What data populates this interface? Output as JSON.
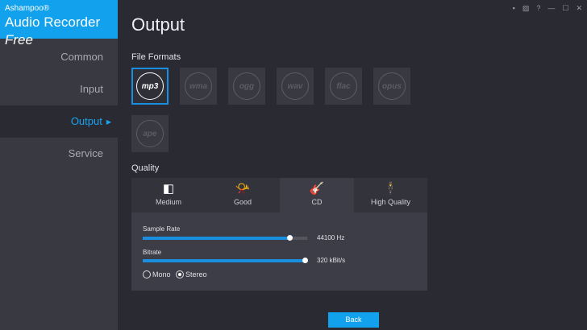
{
  "app": {
    "brand_small": "Ashampoo®",
    "brand_main": "Audio Recorder",
    "brand_italic": "Free"
  },
  "window_controls": [
    {
      "icon": "note-icon",
      "glyph": "▪"
    },
    {
      "icon": "edit-icon",
      "glyph": "▨"
    },
    {
      "icon": "help-icon",
      "glyph": "?"
    },
    {
      "icon": "minimize-icon",
      "glyph": "—"
    },
    {
      "icon": "maximize-icon",
      "glyph": "☐"
    },
    {
      "icon": "close-icon",
      "glyph": "✕"
    }
  ],
  "sidebar": {
    "items": [
      {
        "label": "Common"
      },
      {
        "label": "Input"
      },
      {
        "label": "Output",
        "selected": true
      },
      {
        "label": "Service"
      }
    ]
  },
  "page": {
    "title": "Output",
    "file_formats_label": "File Formats",
    "quality_label": "Quality"
  },
  "formats": [
    {
      "label": "mp3",
      "selected": true
    },
    {
      "label": "wma"
    },
    {
      "label": "ogg"
    },
    {
      "label": "wav"
    },
    {
      "label": "flac"
    },
    {
      "label": "opus"
    },
    {
      "label": "ape"
    }
  ],
  "quality_tabs": [
    {
      "label": "Medium",
      "icon": "speaker-icon",
      "glyph": "◧"
    },
    {
      "label": "Good",
      "icon": "horn-icon",
      "glyph": "📯"
    },
    {
      "label": "CD",
      "icon": "guitar-icon",
      "glyph": "🎸",
      "selected": true
    },
    {
      "label": "High Quality",
      "icon": "conductor-icon",
      "glyph": "🕴"
    }
  ],
  "settings": {
    "sample_rate_label": "Sample Rate",
    "sample_rate_value": "44100 Hz",
    "sample_rate_fraction": 0.89,
    "bitrate_label": "Bitrate",
    "bitrate_value": "320 kBit/s",
    "bitrate_fraction": 1.0,
    "mono_label": "Mono",
    "stereo_label": "Stereo",
    "channel_selected": "Stereo"
  },
  "back_label": "Back",
  "colors": {
    "accent": "#12a1ec",
    "sidebar": "#393942",
    "background": "#2a2a32"
  }
}
